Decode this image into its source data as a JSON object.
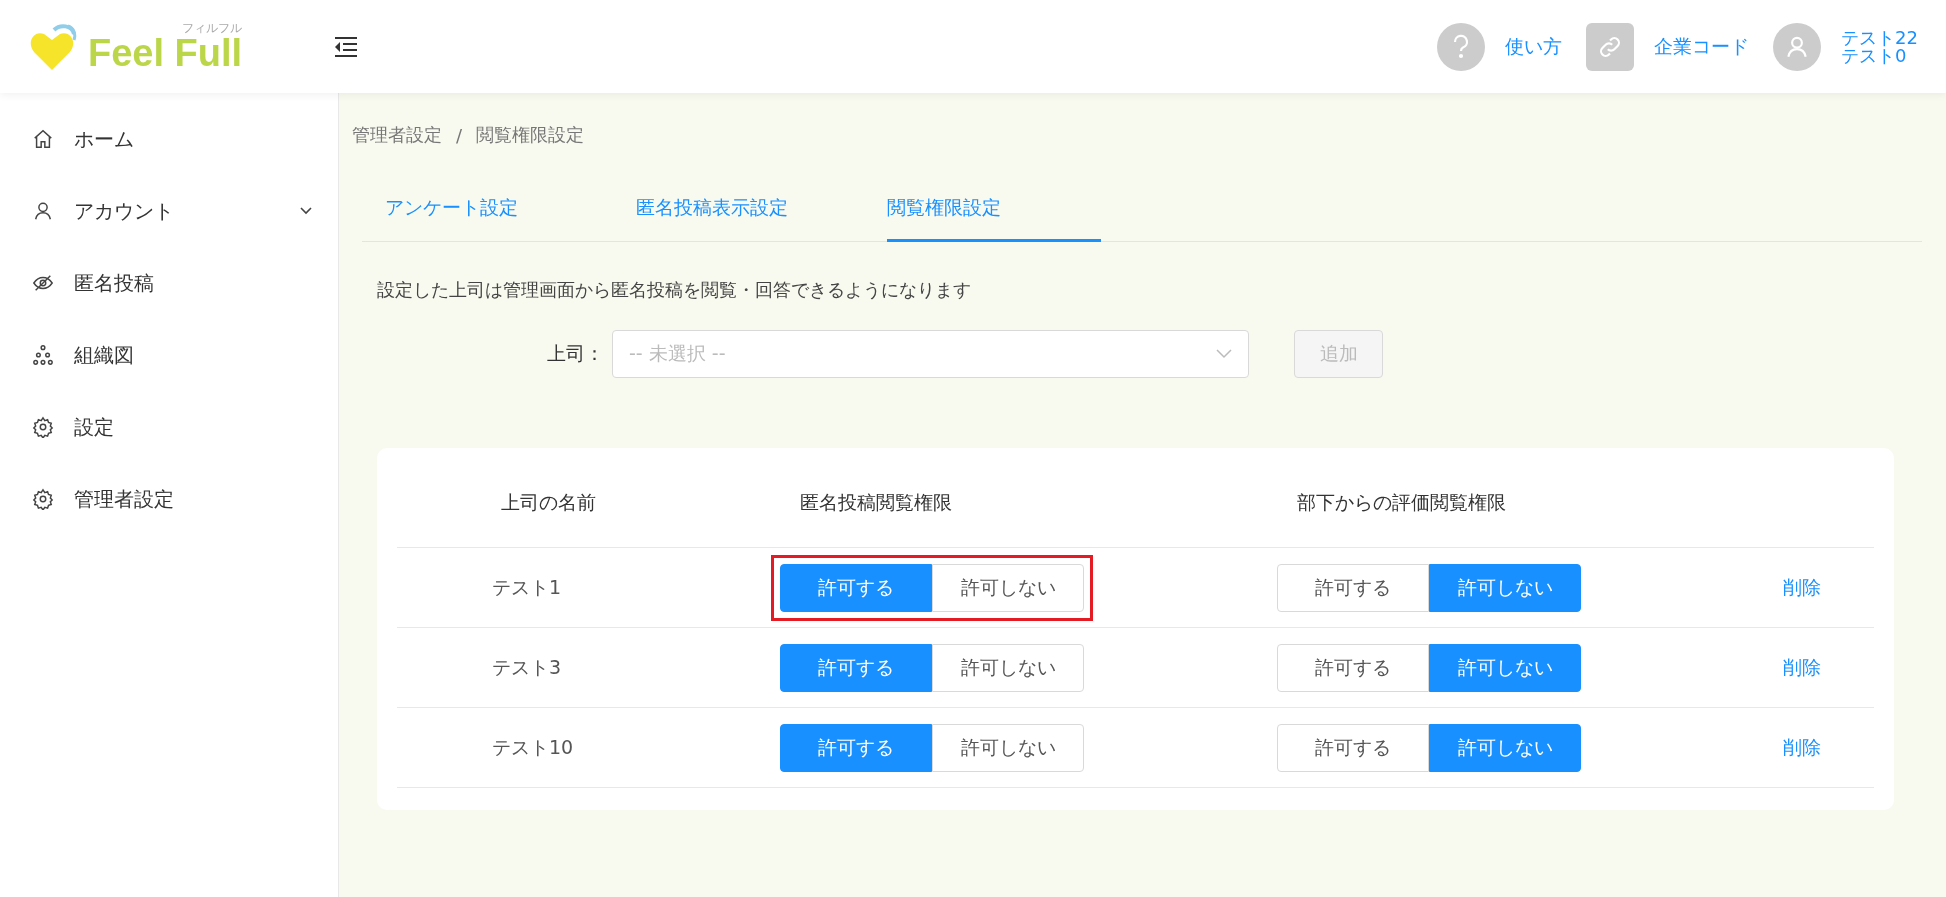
{
  "header": {
    "logo_small": "フィルフル",
    "logo": "Feel Full",
    "help": "使い方",
    "company_code": "企業コード",
    "user_lines": [
      "テスト22",
      "テスト0"
    ]
  },
  "sidebar": {
    "items": [
      {
        "label": "ホーム",
        "kind": "link"
      },
      {
        "label": "アカウント",
        "kind": "group"
      },
      {
        "label": "匿名投稿",
        "kind": "link"
      },
      {
        "label": "組織図",
        "kind": "link"
      },
      {
        "label": "設定",
        "kind": "link"
      },
      {
        "label": "管理者設定",
        "kind": "link"
      }
    ]
  },
  "breadcrumb": [
    "管理者設定",
    "閲覧権限設定"
  ],
  "breadcrumb_separator": "/",
  "tabs": [
    {
      "label": "アンケート設定",
      "selected": false
    },
    {
      "label": "匿名投稿表示設定",
      "selected": false
    },
    {
      "label": "閲覧権限設定",
      "selected": true
    }
  ],
  "description": "設定した上司は管理画面から匿名投稿を閲覧・回答できるようになります",
  "boss_field": {
    "label": "上司：",
    "placeholder": "-- 未選択 --"
  },
  "add_button": {
    "label": "追加",
    "disabled": true
  },
  "table": {
    "columns": [
      "上司の名前",
      "匿名投稿閲覧権限",
      "部下からの評価閲覧権限"
    ],
    "rows": [
      {
        "name": "テスト1",
        "highlighted": true,
        "anonymous": [
          {
            "label": "許可する",
            "selected": true
          },
          {
            "label": "許可しない",
            "selected": false
          }
        ],
        "evaluation": [
          {
            "label": "許可する",
            "selected": false
          },
          {
            "label": "許可しない",
            "selected": true
          }
        ],
        "delete": "削除"
      },
      {
        "name": "テスト3",
        "highlighted": false,
        "anonymous": [
          {
            "label": "許可する",
            "selected": true
          },
          {
            "label": "許可しない",
            "selected": false
          }
        ],
        "evaluation": [
          {
            "label": "許可する",
            "selected": false
          },
          {
            "label": "許可しない",
            "selected": true
          }
        ],
        "delete": "削除"
      },
      {
        "name": "テスト10",
        "highlighted": false,
        "anonymous": [
          {
            "label": "許可する",
            "selected": true
          },
          {
            "label": "許可しない",
            "selected": false
          }
        ],
        "evaluation": [
          {
            "label": "許可する",
            "selected": false
          },
          {
            "label": "許可しない",
            "selected": true
          }
        ],
        "delete": "削除"
      }
    ]
  }
}
